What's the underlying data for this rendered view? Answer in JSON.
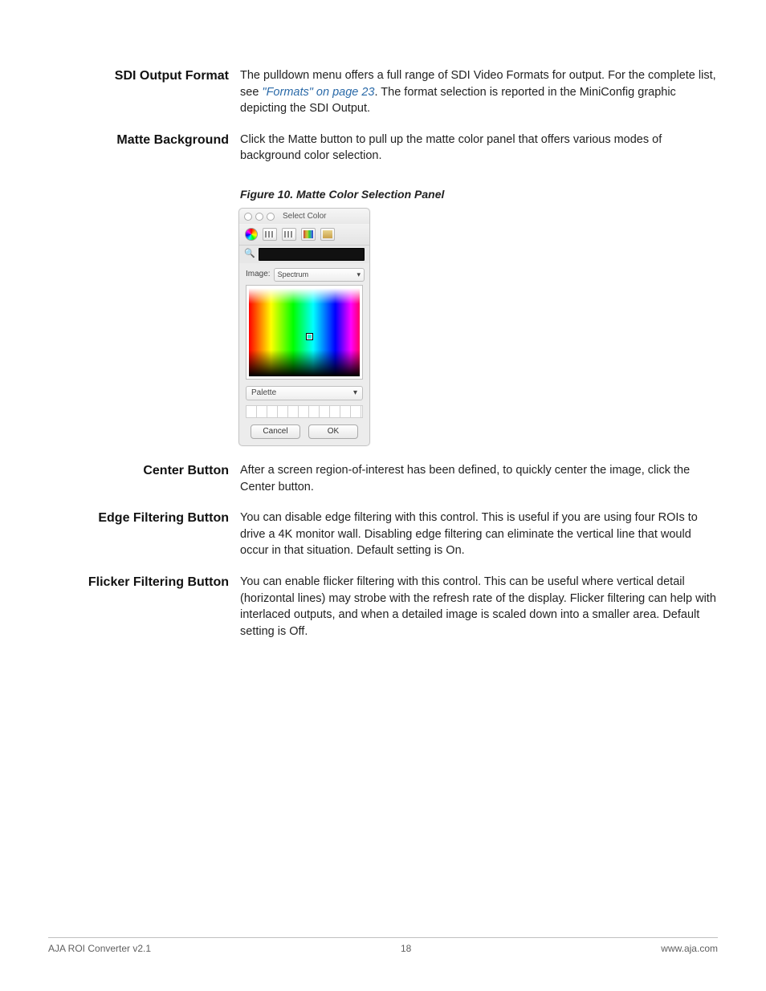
{
  "sections": {
    "sdi": {
      "heading": "SDI Output Format",
      "body_pre": "The pulldown menu offers a full range of SDI Video Formats for output. For the complete list, see ",
      "link": "\"Formats\" on page 23",
      "body_post": ". The format selection is reported in the MiniConfig graphic depicting the SDI Output."
    },
    "matte": {
      "heading": "Matte Background",
      "body": "Click the Matte button to pull up the matte color panel that offers various modes of background color selection."
    },
    "figure": {
      "caption": "Figure 10. Matte Color Selection Panel"
    },
    "center": {
      "heading": "Center Button",
      "body": "After a screen region-of-interest has been defined, to quickly center the image, click the Center button."
    },
    "edge": {
      "heading": "Edge Filtering Button",
      "body": "You can disable edge filtering with this control. This is useful if you are using four ROIs to drive a 4K monitor wall. Disabling edge filtering can eliminate the vertical line that would occur in that situation. Default setting is On."
    },
    "flicker": {
      "heading": "Flicker Filtering Button",
      "body": "You can enable flicker filtering with this control. This can be useful where vertical detail (horizontal lines) may strobe with the refresh rate of the display. Flicker filtering can help with interlaced outputs, and when a detailed image is scaled down into a smaller area. Default setting is Off."
    }
  },
  "dialog": {
    "title": "Select Color",
    "image_label": "Image:",
    "image_value": "Spectrum",
    "palette_label": "Palette",
    "cancel": "Cancel",
    "ok": "OK"
  },
  "footer": {
    "left": "AJA ROI Converter v2.1",
    "center": "18",
    "right": "www.aja.com"
  }
}
